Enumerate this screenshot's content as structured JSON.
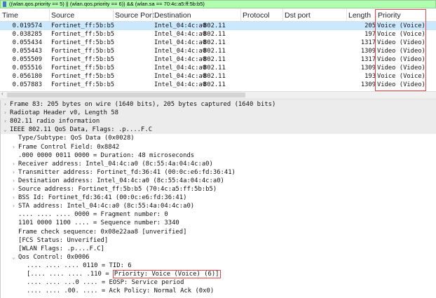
{
  "filter": {
    "text": "((wlan.qos.priority == 5) || (wlan.qos.priority == 6)) && (wlan.sa == 70:4c:a5:ff:5b:b5)"
  },
  "columns": [
    "Time",
    "Source",
    "Source Port",
    "Destination",
    "Protocol",
    "Dst port",
    "Length",
    "Priority"
  ],
  "packets": [
    {
      "time": "0.019574",
      "source": "Fortinet_ff:5b:b5",
      "sport": "",
      "dest": "Intel_04:4c:a0",
      "proto": "802.11",
      "dport": "",
      "len": "205",
      "prio": "Voice (Voice)"
    },
    {
      "time": "0.038285",
      "source": "Fortinet_ff:5b:b5",
      "sport": "",
      "dest": "Intel_04:4c:a0",
      "proto": "802.11",
      "dport": "",
      "len": "197",
      "prio": "Voice (Voice)"
    },
    {
      "time": "0.055434",
      "source": "Fortinet_ff:5b:b5",
      "sport": "",
      "dest": "Intel_04:4c:a0",
      "proto": "802.11",
      "dport": "",
      "len": "1317",
      "prio": "Video (Video)"
    },
    {
      "time": "0.055443",
      "source": "Fortinet_ff:5b:b5",
      "sport": "",
      "dest": "Intel_04:4c:a0",
      "proto": "802.11",
      "dport": "",
      "len": "1309",
      "prio": "Video (Video)"
    },
    {
      "time": "0.055509",
      "source": "Fortinet_ff:5b:b5",
      "sport": "",
      "dest": "Intel_04:4c:a0",
      "proto": "802.11",
      "dport": "",
      "len": "1317",
      "prio": "Video (Video)"
    },
    {
      "time": "0.055516",
      "source": "Fortinet_ff:5b:b5",
      "sport": "",
      "dest": "Intel_04:4c:a0",
      "proto": "802.11",
      "dport": "",
      "len": "1309",
      "prio": "Video (Video)"
    },
    {
      "time": "0.056180",
      "source": "Fortinet_ff:5b:b5",
      "sport": "",
      "dest": "Intel_04:4c:a0",
      "proto": "802.11",
      "dport": "",
      "len": "193",
      "prio": "Voice (Voice)"
    },
    {
      "time": "0.057883",
      "source": "Fortinet_ff:5b:b5",
      "sport": "",
      "dest": "Intel_04:4c:a0",
      "proto": "802.11",
      "dport": "",
      "len": "1309",
      "prio": "Video (Video)"
    }
  ],
  "details": [
    {
      "lvl": 0,
      "tw": ">",
      "text": "Frame 83: 205 bytes on wire (1640 bits), 205 bytes captured (1640 bits)",
      "shade": true
    },
    {
      "lvl": 0,
      "tw": ">",
      "text": "Radiotap Header v0, Length 58",
      "shade": true
    },
    {
      "lvl": 0,
      "tw": ">",
      "text": "802.11 radio information",
      "shade": true
    },
    {
      "lvl": 0,
      "tw": "v",
      "text": "IEEE 802.11 QoS Data, Flags: .p....F.C",
      "shade": true
    },
    {
      "lvl": 1,
      "tw": "",
      "text": "Type/Subtype: QoS Data (0x0028)"
    },
    {
      "lvl": 1,
      "tw": ">",
      "text": "Frame Control Field: 0x8842"
    },
    {
      "lvl": 1,
      "tw": "",
      "text": ".000 0000 0011 0000 = Duration: 48 microseconds"
    },
    {
      "lvl": 1,
      "tw": ">",
      "text": "Receiver address: Intel_04:4c:a0 (8c:55:4a:04:4c:a0)"
    },
    {
      "lvl": 1,
      "tw": ">",
      "text": "Transmitter address: Fortinet_fd:36:41 (00:0c:e6:fd:36:41)"
    },
    {
      "lvl": 1,
      "tw": ">",
      "text": "Destination address: Intel_04:4c:a0 (8c:55:4a:04:4c:a0)"
    },
    {
      "lvl": 1,
      "tw": ">",
      "text": "Source address: Fortinet_ff:5b:b5 (70:4c:a5:ff:5b:b5)"
    },
    {
      "lvl": 1,
      "tw": ">",
      "text": "BSS Id: Fortinet_fd:36:41 (00:0c:e6:fd:36:41)"
    },
    {
      "lvl": 1,
      "tw": ">",
      "text": "STA address: Intel_04:4c:a0 (8c:55:4a:04:4c:a0)"
    },
    {
      "lvl": 1,
      "tw": "",
      "text": ".... .... .... 0000 = Fragment number: 0"
    },
    {
      "lvl": 1,
      "tw": "",
      "text": "1101 0000 1100 .... = Sequence number: 3340"
    },
    {
      "lvl": 1,
      "tw": "",
      "text": "Frame check sequence: 0x08e22aa8 [unverified]"
    },
    {
      "lvl": 1,
      "tw": "",
      "text": "[FCS Status: Unverified]"
    },
    {
      "lvl": 1,
      "tw": "",
      "text": "[WLAN Flags: .p....F.C]"
    },
    {
      "lvl": 1,
      "tw": "v",
      "text": "Qos Control: 0x0006"
    },
    {
      "lvl": 2,
      "tw": "",
      "text": ".... .... .... 0110 = TID: 6"
    },
    {
      "lvl": 2,
      "tw": "",
      "text": "[.... .... .... .110 = ",
      "hl": "Priority: Voice (Voice) (6)]"
    },
    {
      "lvl": 2,
      "tw": "",
      "text": ".... .... ...0 .... = EOSP: Service period"
    },
    {
      "lvl": 2,
      "tw": "",
      "text": ".... .... .00. .... = Ack Policy: Normal Ack (0x0)"
    }
  ],
  "colors": {
    "filter_bg": "#afffaf",
    "selected_row": "#cce8ff",
    "highlight_box": "#e8454a"
  }
}
